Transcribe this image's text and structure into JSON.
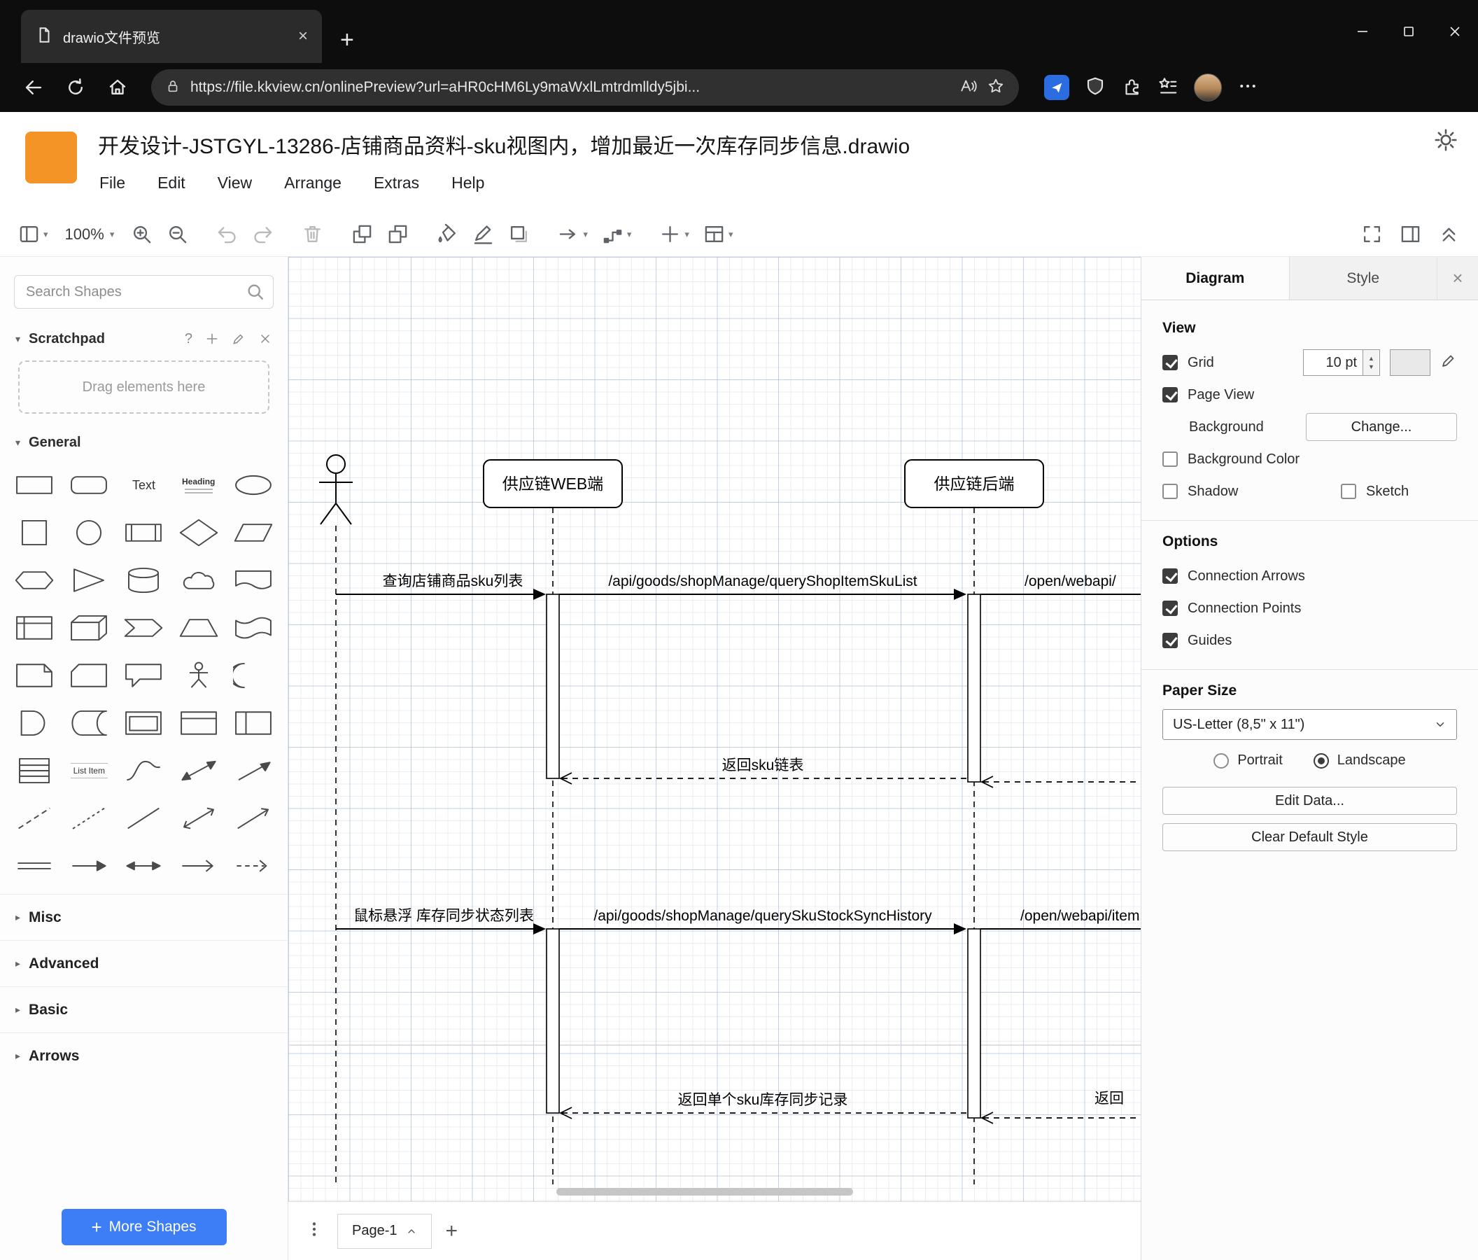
{
  "colors": {
    "brand_orange": "#f49426",
    "accent_blue": "#3d7ef7",
    "ext_blue": "#2b6de0"
  },
  "browser": {
    "tab_title": "drawio文件预览",
    "url": "https://file.kkview.cn/onlinePreview?url=aHR0cHM6Ly9maWxlLmtrdmlldy5jbi...",
    "icons": [
      "page",
      "close-tab",
      "new-tab",
      "back",
      "refresh",
      "home",
      "lock",
      "read-aloud",
      "favorite-star",
      "extension-blue",
      "extension-shield",
      "extensions-puzzle",
      "favorites-bar",
      "profile-avatar",
      "more-menu",
      "minimize",
      "maximize",
      "close"
    ]
  },
  "header": {
    "title": "开发设计-JSTGYL-13286-店铺商品资料-sku视图内，增加最近一次库存同步信息.drawio",
    "menus": [
      "File",
      "Edit",
      "View",
      "Arrange",
      "Extras",
      "Help"
    ],
    "theme_icon": "sun"
  },
  "toolbar": {
    "zoom": "100%",
    "left_icons": [
      "view-layout",
      "zoom-dropdown",
      "zoom-in",
      "zoom-out",
      "undo",
      "redo",
      "delete",
      "to-front",
      "to-back",
      "fill-color",
      "line-color",
      "shadow",
      "connection",
      "waypoints",
      "insert",
      "table"
    ],
    "right_icons": [
      "fullscreen",
      "format-panel",
      "collapse-toolbar"
    ]
  },
  "sidebar": {
    "search_placeholder": "Search Shapes",
    "scratchpad": {
      "title": "Scratchpad",
      "help_icon": "?",
      "dropzone_text": "Drag elements here"
    },
    "sections": {
      "general": "General",
      "misc": "Misc",
      "advanced": "Advanced",
      "basic": "Basic",
      "arrows": "Arrows"
    },
    "shape_labels": {
      "text": "Text",
      "heading": "Heading",
      "list_item": "List Item"
    },
    "shapes": [
      "rectangle",
      "rounded-rectangle",
      "text",
      "heading",
      "ellipse",
      "square",
      "circle",
      "process",
      "diamond",
      "parallelogram",
      "hexagon",
      "triangle",
      "cylinder",
      "cloud",
      "document",
      "internal-storage",
      "cube",
      "step",
      "trapezoid",
      "tape",
      "note",
      "card",
      "callout",
      "actor",
      "or",
      "and",
      "data-storage",
      "container",
      "vertical-container",
      "horizontal-container",
      "list",
      "list-item",
      "curve",
      "bidirectional-arrow",
      "arrow",
      "dashed-line",
      "dotted-line",
      "line",
      "bidirectional-connector",
      "directional-connector",
      "link",
      "directional-link",
      "bidirectional-link",
      "arrow-connector",
      "dashed-connector"
    ],
    "more_shapes": "More Shapes"
  },
  "canvas": {
    "lifelines": {
      "web": "供应链WEB端",
      "backend": "供应链后端"
    },
    "messages": {
      "m1": "查询店铺商品sku列表",
      "m2": "/api/goods/shopManage/queryShopItemSkuList",
      "m3": "/open/webapi/",
      "r1": "返回sku链表",
      "m4": "鼠标悬浮 库存同步状态列表",
      "m5": "/api/goods/shopManage/querySkuStockSyncHistory",
      "m6": "/open/webapi/item",
      "r2": "返回单个sku库存同步记录",
      "r3": "返回"
    },
    "page_tab": "Page-1"
  },
  "format_panel": {
    "tabs": {
      "diagram": "Diagram",
      "style": "Style"
    },
    "view": {
      "heading": "View",
      "grid": "Grid",
      "grid_size": "10 pt",
      "page_view": "Page View",
      "background": "Background",
      "change_button": "Change...",
      "background_color": "Background Color",
      "shadow": "Shadow",
      "sketch": "Sketch"
    },
    "options": {
      "heading": "Options",
      "connection_arrows": "Connection Arrows",
      "connection_points": "Connection Points",
      "guides": "Guides"
    },
    "paper": {
      "heading": "Paper Size",
      "size_value": "US-Letter (8,5\" x 11\")",
      "portrait": "Portrait",
      "landscape": "Landscape"
    },
    "buttons": {
      "edit_data": "Edit Data...",
      "clear_default_style": "Clear Default Style"
    }
  }
}
